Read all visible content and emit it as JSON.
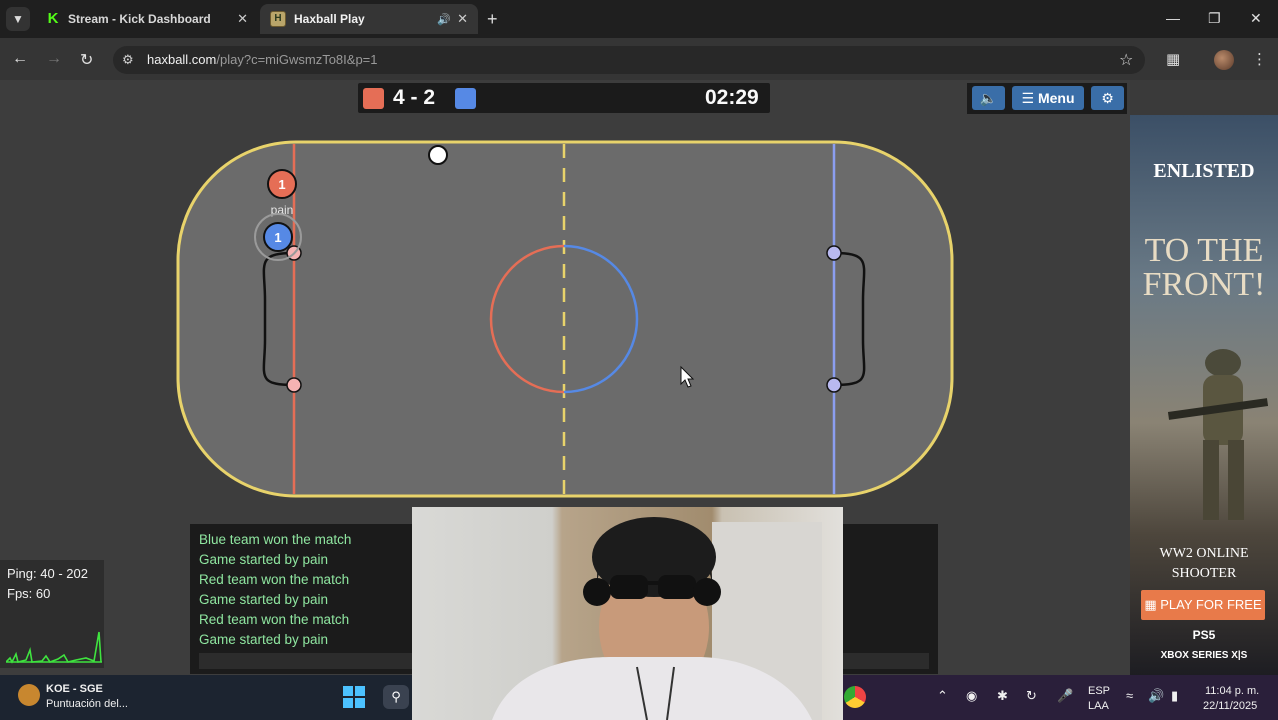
{
  "browser": {
    "tabs": [
      {
        "title": "Stream - Kick Dashboard",
        "icon": "kick-favicon",
        "active": false
      },
      {
        "title": "Haxball Play",
        "icon": "haxball-favicon",
        "active": true
      }
    ],
    "url_host": "haxball.com",
    "url_path": "/play?c=miGwsmzTo8I&p=1"
  },
  "game": {
    "red_score": "4",
    "separator": "-",
    "blue_score": "2",
    "timer": "02:29",
    "menu_label": "Menu",
    "player_number_red": "1",
    "player_number_blue": "1",
    "player_name": "pain",
    "colors": {
      "red": "#e56e56",
      "blue": "#5689e5",
      "border": "#e8d36b",
      "field": "#6b6b6b"
    }
  },
  "chat": {
    "lines": [
      "Blue team won the match",
      "Game started by pain",
      "Red team won the match",
      "Game started by pain",
      "Red team won the match",
      "Game started by pain"
    ]
  },
  "stats": {
    "ping": "Ping: 40 - 202",
    "fps": "Fps: 60"
  },
  "ad": {
    "brand": "ENLISTED",
    "headline": "TO THE FRONT!",
    "sub1": "WW2 ONLINE",
    "sub2": "SHOOTER",
    "cta": "PLAY FOR FREE",
    "platform1": "PS5",
    "platform2": "XBOX SERIES X|S"
  },
  "taskbar": {
    "app_title": "KOE - SGE",
    "app_sub": "Puntuación del...",
    "lang1": "ESP",
    "lang2": "LAA",
    "time": "11:04 p. m.",
    "date": "22/11/2025"
  }
}
